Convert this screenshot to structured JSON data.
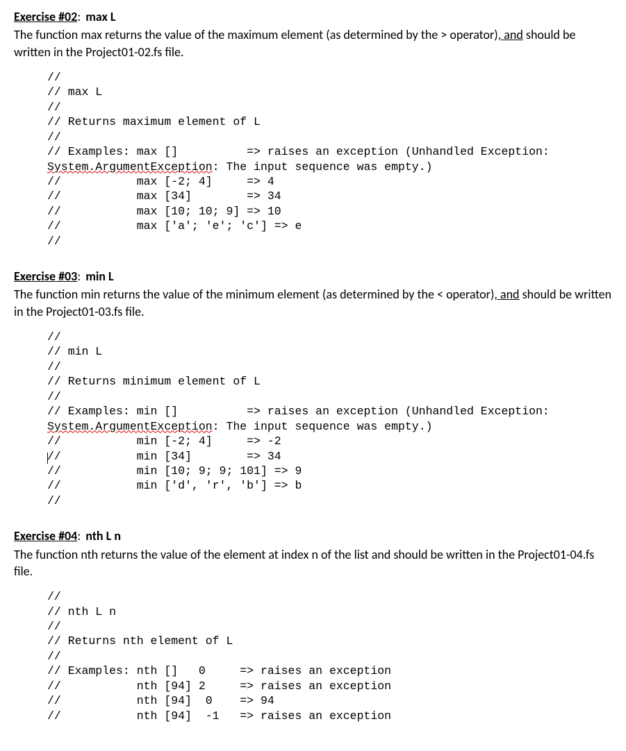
{
  "ex02": {
    "label": "Exercise #02",
    "sig": "max L",
    "desc_pre": "The function max returns the value of the maximum element (as determined by the > operator)",
    "ins": ", and",
    "desc_post": " should be written in the Project01-02.fs file.",
    "code_lines": {
      "l0": "//",
      "l1": "// max L",
      "l2": "//",
      "l3": "// Returns maximum element of L",
      "l4": "//",
      "l5": "// Examples: max []          => raises an exception (Unhandled Exception:",
      "l6a": "System.ArgumentException",
      "l6b": ": The input sequence was empty.)",
      "l7": "//           max [-2; 4]     => 4",
      "l8": "//           max [34]        => 34",
      "l9": "//           max [10; 10; 9] => 10",
      "l10": "//           max ['a'; 'e'; 'c'] => e",
      "l11": "//"
    }
  },
  "ex03": {
    "label": "Exercise #03",
    "sig": "min L",
    "desc_pre": "The function min returns the value of the minimum element (as determined by the < operator)",
    "ins": ", and",
    "desc_post": " should be written in the Project01-03.fs file.",
    "code_lines": {
      "l0": "//",
      "l1": "// min L",
      "l2": "//",
      "l3": "// Returns minimum element of L",
      "l4": "//",
      "l5": "// Examples: min []          => raises an exception (Unhandled Exception:",
      "l6a": "System.ArgumentException",
      "l6b": ": The input sequence was empty.)",
      "l7": "//           min [-2; 4]     => -2",
      "l8_prefix": "/",
      "l8_rest": "           min [34]        => 34",
      "l9": "//           min [10; 9; 9; 101] => 9",
      "l10": "//           min ['d', 'r', 'b'] => b",
      "l11": "//"
    }
  },
  "ex04": {
    "label": "Exercise #04",
    "sig": "nth L n",
    "desc": "The function nth returns the value of the element at index n of the list and should be written in the Project01-04.fs file.",
    "code_lines": {
      "l0": "//",
      "l1": "// nth L n",
      "l2": "//",
      "l3": "// Returns nth element of L",
      "l4": "//",
      "l5": "// Examples: nth []   0     => raises an exception",
      "l6": "//           nth [94] 2     => raises an exception",
      "l7": "//           nth [94]  0    => 94",
      "l8": "//           nth [94]  -1   => raises an exception"
    }
  }
}
